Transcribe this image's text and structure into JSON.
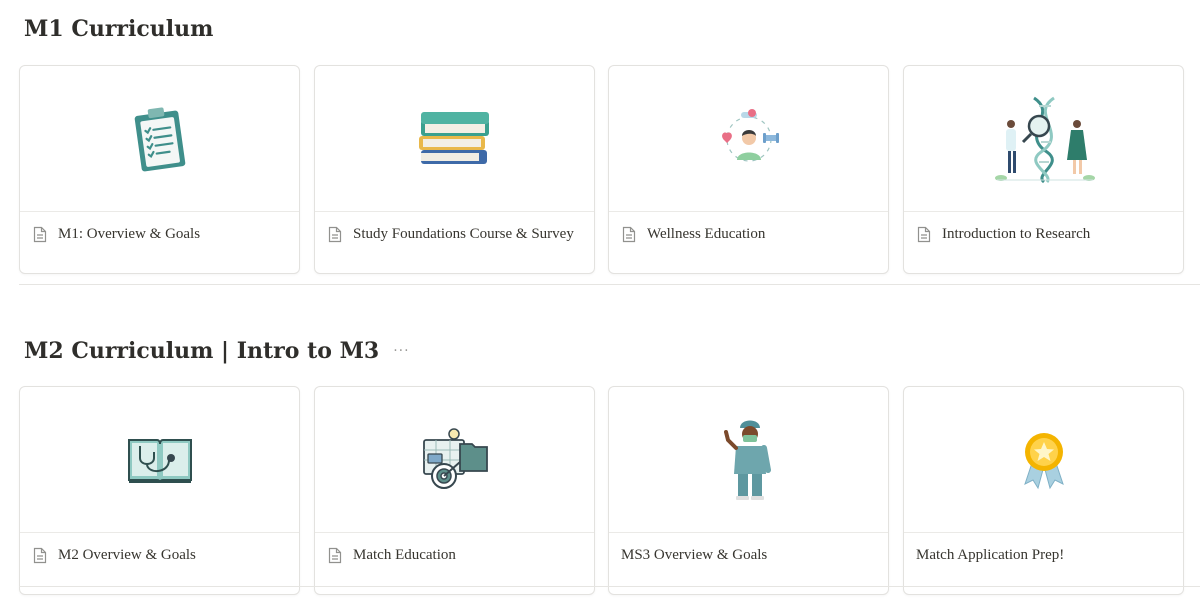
{
  "sections": [
    {
      "title": "M1 Curriculum",
      "cards": [
        {
          "label": "M1: Overview & Goals",
          "illustration": "clipboard-checklist-icon",
          "has_doc_icon": true
        },
        {
          "label": "Study Foundations Course & Survey",
          "illustration": "book-stack-icon",
          "has_doc_icon": true
        },
        {
          "label": "Wellness Education",
          "illustration": "wellness-person-icon",
          "has_doc_icon": true
        },
        {
          "label": "Introduction to Research",
          "illustration": "dna-research-icon",
          "has_doc_icon": true
        }
      ]
    },
    {
      "title": "M2 Curriculum | Intro to M3",
      "more": "···",
      "cards": [
        {
          "label": "M2 Overview & Goals",
          "illustration": "open-book-stethoscope-icon",
          "has_doc_icon": true
        },
        {
          "label": "Match Education",
          "illustration": "target-planning-icon",
          "has_doc_icon": true
        },
        {
          "label": "MS3 Overview & Goals",
          "illustration": "doctor-scrubs-icon",
          "has_doc_icon": false
        },
        {
          "label": "Match Application Prep!",
          "illustration": "award-ribbon-icon",
          "has_doc_icon": false
        }
      ]
    }
  ],
  "colors": {
    "teal": "#3f8f8b",
    "teal_light": "#8fc9c2",
    "text": "#37352f",
    "border": "#e3e2df"
  }
}
